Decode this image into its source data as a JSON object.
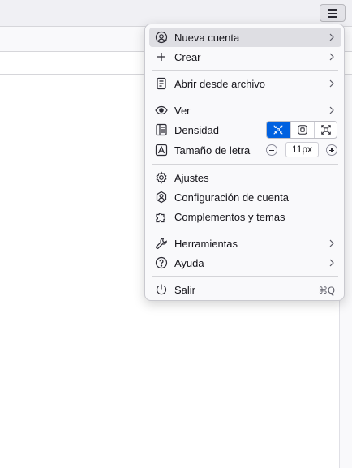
{
  "menu": {
    "new_account": "Nueva cuenta",
    "create": "Crear",
    "open_file": "Abrir desde archivo",
    "view": "Ver",
    "density": "Densidad",
    "font_size": "Tamaño de letra",
    "font_size_value": "11px",
    "settings": "Ajustes",
    "account_settings": "Configuración de cuenta",
    "addons": "Complementos y temas",
    "tools": "Herramientas",
    "help": "Ayuda",
    "quit": "Salir",
    "quit_shortcut": "⌘Q"
  },
  "density_options": [
    {
      "icon": "density-compact-icon",
      "selected": true
    },
    {
      "icon": "density-normal-icon",
      "selected": false
    },
    {
      "icon": "density-touch-icon",
      "selected": false
    }
  ],
  "colors": {
    "accent": "#0061e0",
    "highlight": "#dedee3",
    "menu_bg": "#f9f9fb"
  }
}
